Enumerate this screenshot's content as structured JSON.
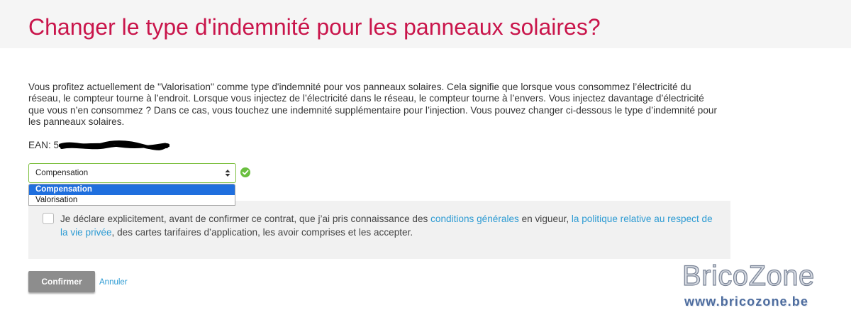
{
  "page": {
    "title": "Changer le type d'indemnité pour les panneaux solaires?"
  },
  "intro": {
    "lines": [
      "Vous profitez actuellement de \"Valorisation\" comme type d'indemnité pour vos panneaux solaires. Cela signifie que lorsque vous consommez l’électricité du",
      "réseau, le compteur tourne à l’endroit. Lorsque vous injectez de l’électricité dans le réseau, le compteur tourne à l’envers. Vous injectez davantage d’électricité",
      "que vous n’en consommez ? Dans ce cas, vous touchez une indemnité supplémentaire pour l’injection. Vous pouvez changer ci-dessous le type d’indemnité pour",
      "les panneaux solaires."
    ]
  },
  "ean": {
    "label": "EAN:",
    "value_visible": "5"
  },
  "compensation_select": {
    "selected": "Compensation",
    "options": [
      "Compensation",
      "Valorisation"
    ],
    "highlighted_option": 0,
    "is_open": true,
    "validated": true
  },
  "consent": {
    "checked": false,
    "text_before": "Je déclare explicitement, avant de confirmer ce contrat, que j’ai pris connaissance des ",
    "link_terms": "conditions générales",
    "text_middle": " en vigueur, ",
    "link_privacy": "la politique relative au respect de la vie privée",
    "text_after": ", des cartes tarifaires d’application, les avoir comprises et les accepter."
  },
  "actions": {
    "confirm_label": "Confirmer",
    "cancel_label": "Annuler"
  },
  "watermark": {
    "brand": "BricoZone",
    "site": "www.bricozone.be"
  },
  "icons": {
    "select_arrows": "updown-arrows-icon",
    "validation": "check-circle-icon",
    "redaction": "redaction-scribble"
  },
  "colors": {
    "title": "#c9154b",
    "link": "#2d9bd3",
    "select_border": "#7dbf3f",
    "valid_check": "#6abf3f",
    "option_highlight": "#1f6fde",
    "confirm_button": "#8d8d8d",
    "consent_panel": "#f1f1f1",
    "header_band": "#f5f5f5"
  }
}
